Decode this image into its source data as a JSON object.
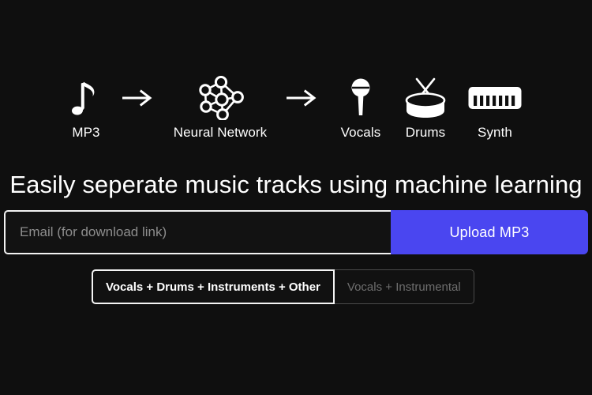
{
  "pipeline": {
    "stages": [
      {
        "label": "MP3",
        "icon": "music-note-icon"
      },
      {
        "label": "Neural Network",
        "icon": "neural-network-icon"
      },
      {
        "label": "Vocals",
        "icon": "microphone-icon"
      },
      {
        "label": "Drums",
        "icon": "drum-icon"
      },
      {
        "label": "Synth",
        "icon": "keyboard-synth-icon"
      }
    ],
    "arrow_glyph": "→"
  },
  "headline": "Easily seperate music tracks using machine learning",
  "signup": {
    "email_placeholder": "Email (for download link)",
    "email_value": "",
    "upload_label": "Upload MP3",
    "accent_color": "#4a46f0"
  },
  "mode_toggle": {
    "options": [
      {
        "label": "Vocals + Drums + Instruments + Other",
        "selected": true
      },
      {
        "label": "Vocals + Instrumental",
        "selected": false
      }
    ]
  },
  "colors": {
    "background": "#0f0f0f",
    "text": "#ffffff",
    "muted_text": "#6e6e6e",
    "placeholder": "#8d8d8d",
    "accent": "#4a46f0"
  }
}
